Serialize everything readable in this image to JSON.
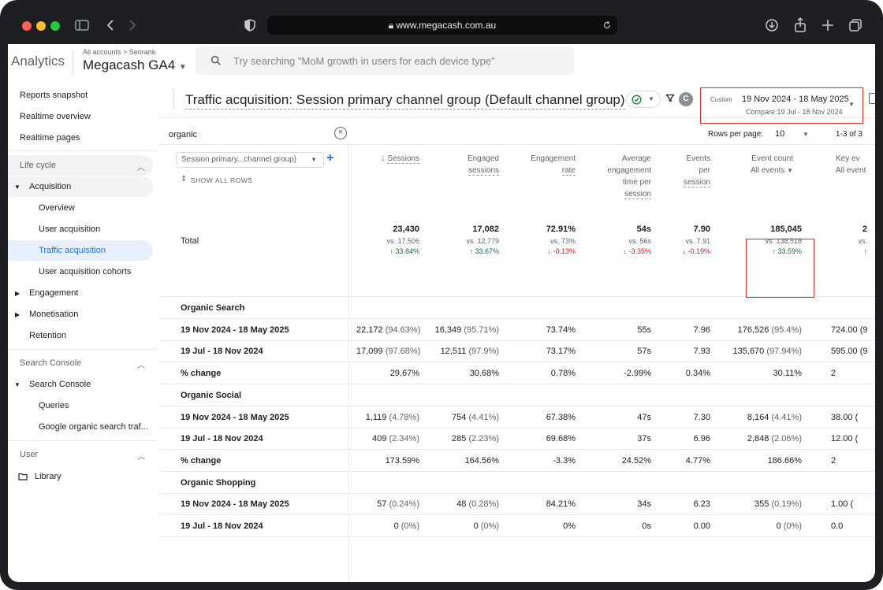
{
  "browser": {
    "url": "www.megacash.com.au",
    "lock_icon": "lock-icon",
    "colors": {
      "close": "#ff5f57",
      "minimize": "#febc2e",
      "zoom": "#28c840"
    }
  },
  "header": {
    "brand": "Analytics",
    "breadcrumb": "All accounts > Seorank",
    "property": "Megacash GA4",
    "search_placeholder": "Try searching \"MoM growth in users for each device type\""
  },
  "sidebar": {
    "items": [
      {
        "label": "Reports snapshot"
      },
      {
        "label": "Realtime overview"
      },
      {
        "label": "Realtime pages"
      },
      {
        "label": "Life cycle"
      },
      {
        "label": "Acquisition"
      },
      {
        "label": "Overview"
      },
      {
        "label": "User acquisition"
      },
      {
        "label": "Traffic acquisition"
      },
      {
        "label": "User acquisition cohorts"
      },
      {
        "label": "Engagement"
      },
      {
        "label": "Monetisation"
      },
      {
        "label": "Retention"
      },
      {
        "label": "Search Console"
      },
      {
        "label": "Search Console"
      },
      {
        "label": "Queries"
      },
      {
        "label": "Google organic search traf..."
      },
      {
        "label": "User"
      },
      {
        "label": "Library"
      }
    ]
  },
  "report": {
    "title": "Traffic acquisition: Session primary channel group (Default channel group)",
    "avatar": "C",
    "date": {
      "custom_label": "Custom",
      "range": "19 Nov 2024 - 18 May 2025",
      "compare": "Compare:19 Jul - 18 Nov 2024"
    },
    "search_value": "organic",
    "rows_per_page_label": "Rows per page:",
    "rows_per_page": "10",
    "page_range": "1-3 of 3",
    "dimension_label": "Session primary...channel group)",
    "show_all_rows": "SHOW ALL ROWS",
    "total_label": "Total"
  },
  "columns": {
    "sessions": {
      "l1": "Sessions"
    },
    "engaged": {
      "l1": "Engaged",
      "l2": "sessions"
    },
    "engrate": {
      "l1": "Engagement",
      "l2": "rate"
    },
    "avgtime": {
      "l1": "Average",
      "l2": "engagement",
      "l3": "time per",
      "l4": "session"
    },
    "events": {
      "l1": "Events",
      "l2": "per",
      "l3": "session"
    },
    "eventcount": {
      "l1": "Event count",
      "l2": "All events"
    },
    "keyev": {
      "l1": "Key ev",
      "l2": "All event"
    }
  },
  "totals": {
    "sessions": {
      "v": "23,430",
      "vs": "vs. 17,506",
      "ch": "↑ 33.84%"
    },
    "engaged": {
      "v": "17,082",
      "vs": "vs. 12,779",
      "ch": "↑ 33.67%"
    },
    "engrate": {
      "v": "72.91%",
      "vs": "vs. 73%",
      "ch": "↓ -0.13%"
    },
    "avgtime": {
      "v": "54s",
      "vs": "vs. 56s",
      "ch": "↓ -3.35%"
    },
    "events": {
      "v": "7.90",
      "vs": "vs. 7.91",
      "ch": "↓ -0.19%"
    },
    "eventcount": {
      "v": "185,045",
      "vs": "vs. 138,518",
      "ch": "↑ 33.59%"
    },
    "keyev": {
      "v": "2",
      "vs": "vs.",
      "ch": "↑"
    }
  },
  "rows": [
    {
      "label": "Organic Search"
    },
    {
      "label": "19 Nov 2024 - 18 May 2025",
      "sessions": "22,172",
      "sessions_pct": "(94.63%)",
      "engaged": "16,349",
      "engaged_pct": "(95.71%)",
      "engrate": "73.74%",
      "avgtime": "55s",
      "events": "7.96",
      "eventcount": "176,526",
      "eventcount_pct": "(95.4%)",
      "keyev": "724.00 (9"
    },
    {
      "label": "19 Jul - 18 Nov 2024",
      "sessions": "17,099",
      "sessions_pct": "(97.68%)",
      "engaged": "12,511",
      "engaged_pct": "(97.9%)",
      "engrate": "73.17%",
      "avgtime": "57s",
      "events": "7.93",
      "eventcount": "135,670",
      "eventcount_pct": "(97.94%)",
      "keyev": "595.00 (9"
    },
    {
      "label": "% change",
      "sessions": "29.67%",
      "engaged": "30.68%",
      "engrate": "0.78%",
      "avgtime": "-2.99%",
      "events": "0.34%",
      "eventcount": "30.11%",
      "keyev": "2"
    },
    {
      "label": "Organic Social"
    },
    {
      "label": "19 Nov 2024 - 18 May 2025",
      "sessions": "1,119",
      "sessions_pct": "(4.78%)",
      "engaged": "754",
      "engaged_pct": "(4.41%)",
      "engrate": "67.38%",
      "avgtime": "47s",
      "events": "7.30",
      "eventcount": "8,164",
      "eventcount_pct": "(4.41%)",
      "keyev": "38.00 ("
    },
    {
      "label": "19 Jul - 18 Nov 2024",
      "sessions": "409",
      "sessions_pct": "(2.34%)",
      "engaged": "285",
      "engaged_pct": "(2.23%)",
      "engrate": "69.68%",
      "avgtime": "37s",
      "events": "6.96",
      "eventcount": "2,848",
      "eventcount_pct": "(2.06%)",
      "keyev": "12.00 ("
    },
    {
      "label": "% change",
      "sessions": "173.59%",
      "engaged": "164.56%",
      "engrate": "-3.3%",
      "avgtime": "24.52%",
      "events": "4.77%",
      "eventcount": "186.66%",
      "keyev": "2"
    },
    {
      "label": "Organic Shopping"
    },
    {
      "label": "19 Nov 2024 - 18 May 2025",
      "sessions": "57",
      "sessions_pct": "(0.24%)",
      "engaged": "48",
      "engaged_pct": "(0.28%)",
      "engrate": "84.21%",
      "avgtime": "34s",
      "events": "6.23",
      "eventcount": "355",
      "eventcount_pct": "(0.19%)",
      "keyev": "1.00 ("
    },
    {
      "label": "19 Jul - 18 Nov 2024",
      "sessions": "0",
      "sessions_pct": "(0%)",
      "engaged": "0",
      "engaged_pct": "(0%)",
      "engrate": "0%",
      "avgtime": "0s",
      "events": "0.00",
      "eventcount": "0",
      "eventcount_pct": "(0%)",
      "keyev": "0.0"
    }
  ]
}
